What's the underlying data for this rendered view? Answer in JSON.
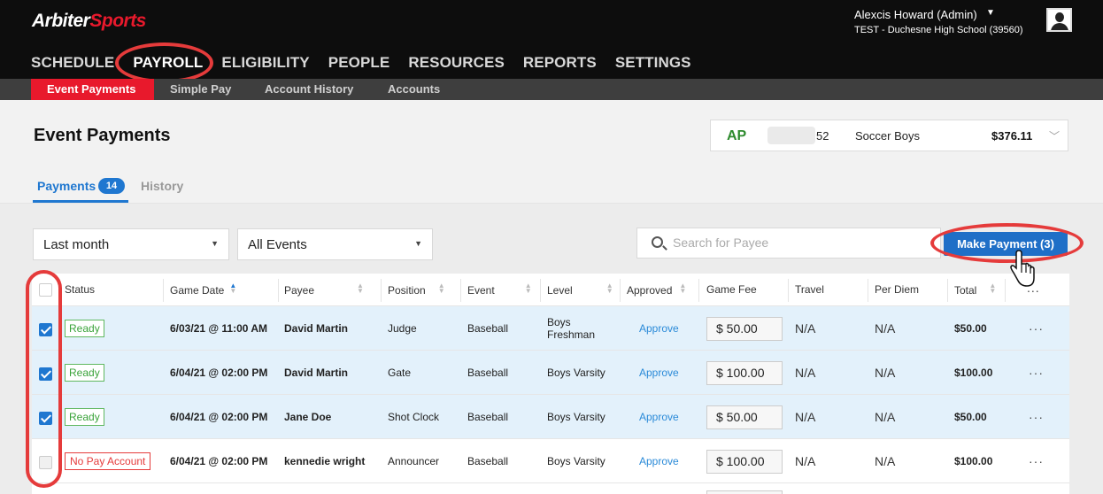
{
  "brand": {
    "part1": "Arbiter",
    "part2": "Sports"
  },
  "user": {
    "name": "Alexcis Howard (Admin)",
    "org": "TEST - Duchesne High School (39560)"
  },
  "main_nav": [
    {
      "label": "SCHEDULE",
      "active": false
    },
    {
      "label": "PAYROLL",
      "active": true
    },
    {
      "label": "ELIGIBILITY",
      "active": false
    },
    {
      "label": "PEOPLE",
      "active": false
    },
    {
      "label": "RESOURCES",
      "active": false
    },
    {
      "label": "REPORTS",
      "active": false
    },
    {
      "label": "SETTINGS",
      "active": false
    }
  ],
  "sub_nav": [
    {
      "label": "Event Payments",
      "active": true
    },
    {
      "label": "Simple Pay",
      "active": false
    },
    {
      "label": "Account History",
      "active": false
    },
    {
      "label": "Accounts",
      "active": false
    }
  ],
  "page": {
    "title": "Event Payments"
  },
  "account_selector": {
    "type": "AP",
    "number": "52",
    "name": "Soccer Boys",
    "balance": "$376.11"
  },
  "tabs": {
    "payments_label": "Payments",
    "payments_count": "14",
    "history_label": "History"
  },
  "filters": {
    "date_range": "Last month",
    "events": "All Events",
    "search_placeholder": "Search for Payee",
    "make_payment_label": "Make Payment (3)"
  },
  "table": {
    "headers": [
      "Status",
      "Game Date",
      "Payee",
      "Position",
      "Event",
      "Level",
      "Approved",
      "Game Fee",
      "Travel",
      "Per Diem",
      "Total",
      "..."
    ],
    "rows": [
      {
        "selected": true,
        "status": "Ready",
        "status_kind": "ready",
        "date": "6/03/21 @ 11:00 AM",
        "payee": "David Martin",
        "position": "Judge",
        "event": "Baseball",
        "level": "Boys Freshman",
        "approved": "Approve",
        "fee": "$ 50.00",
        "travel": "N/A",
        "per_diem": "N/A",
        "total": "$50.00",
        "more": "···"
      },
      {
        "selected": true,
        "status": "Ready",
        "status_kind": "ready",
        "date": "6/04/21 @ 02:00 PM",
        "payee": "David Martin",
        "position": "Gate",
        "event": "Baseball",
        "level": "Boys Varsity",
        "approved": "Approve",
        "fee": "$ 100.00",
        "travel": "N/A",
        "per_diem": "N/A",
        "total": "$100.00",
        "more": "···"
      },
      {
        "selected": true,
        "status": "Ready",
        "status_kind": "ready",
        "date": "6/04/21 @ 02:00 PM",
        "payee": "Jane Doe",
        "position": "Shot Clock",
        "event": "Baseball",
        "level": "Boys Varsity",
        "approved": "Approve",
        "fee": "$ 50.00",
        "travel": "N/A",
        "per_diem": "N/A",
        "total": "$50.00",
        "more": "···"
      },
      {
        "selected": false,
        "status": "No Pay Account",
        "status_kind": "nopay",
        "date": "6/04/21 @ 02:00 PM",
        "payee": "kennedie wright",
        "position": "Announcer",
        "event": "Baseball",
        "level": "Boys Varsity",
        "approved": "Approve",
        "fee": "$ 100.00",
        "travel": "N/A",
        "per_diem": "N/A",
        "total": "$100.00",
        "more": "···"
      }
    ]
  },
  "colors": {
    "brand_red": "#e8192c",
    "primary_blue": "#1f77d0",
    "annotation_red": "#e53b3b",
    "ready_green": "#3aa33a",
    "selected_row": "#e3f1fb"
  }
}
